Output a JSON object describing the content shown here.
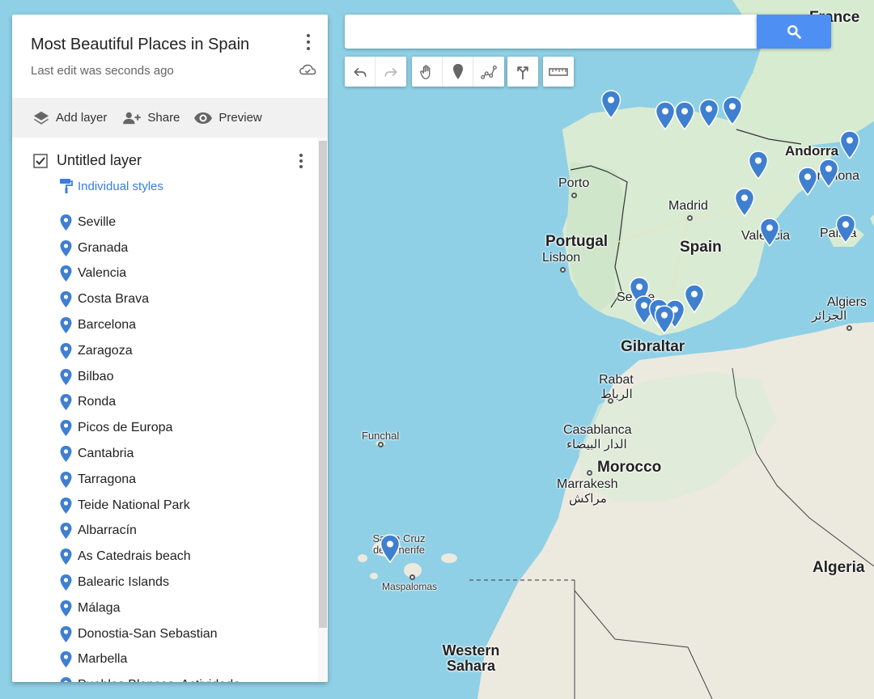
{
  "panel": {
    "title": "Most Beautiful Places in Spain",
    "subtitle": "Last edit was seconds ago",
    "actions": {
      "add_layer": "Add layer",
      "share": "Share",
      "preview": "Preview"
    }
  },
  "layer": {
    "title": "Untitled layer",
    "checked": true,
    "styles_link": "Individual styles",
    "places": [
      "Seville",
      "Granada",
      "Valencia",
      "Costa Brava",
      "Barcelona",
      "Zaragoza",
      "Bilbao",
      "Ronda",
      "Picos de Europa",
      "Cantabria",
      "Tarragona",
      "Teide National Park",
      "Albarracín",
      "As Catedrais beach",
      "Balearic Islands",
      "Málaga",
      "Donostia-San Sebastian",
      "Marbella",
      "Pueblos Blancos, Actividade"
    ]
  },
  "search": {
    "value": "",
    "placeholder": ""
  },
  "toolbar": {
    "icons": [
      "undo-icon",
      "redo-icon",
      "hand-icon",
      "marker-icon",
      "line-icon",
      "directions-icon",
      "ruler-icon"
    ]
  },
  "map": {
    "labels": {
      "france": "France",
      "andorra": "Andorra",
      "barcelona": "Barcelona",
      "porto": "Porto",
      "madrid": "Madrid",
      "portugal": "Portugal",
      "lisbon": "Lisbon",
      "spain": "Spain",
      "valencia": "Valencia",
      "palma": "Palma",
      "seville": "Seville",
      "gibraltar": "Gibraltar",
      "algiers": "Algiers",
      "algiers_ar": "الجزائر",
      "rabat": "Rabat",
      "rabat_ar": "الرباط",
      "casablanca": "Casablanca",
      "casablanca_ar": "الدار البيضاء",
      "morocco": "Morocco",
      "marrakesh": "Marrakesh",
      "marrakesh_ar": "مراكش",
      "funchal": "Funchal",
      "santa_cruz": "Santa Cruz de Tenerife",
      "maspalomas": "Maspalomas",
      "algeria": "Algeria",
      "western_sahara": "Western Sahara"
    },
    "colors": {
      "sea": "#8fd0e6",
      "land_north": "#cfe8cf",
      "land_south": "#ece9df",
      "pin": "#3f7fd0"
    }
  }
}
